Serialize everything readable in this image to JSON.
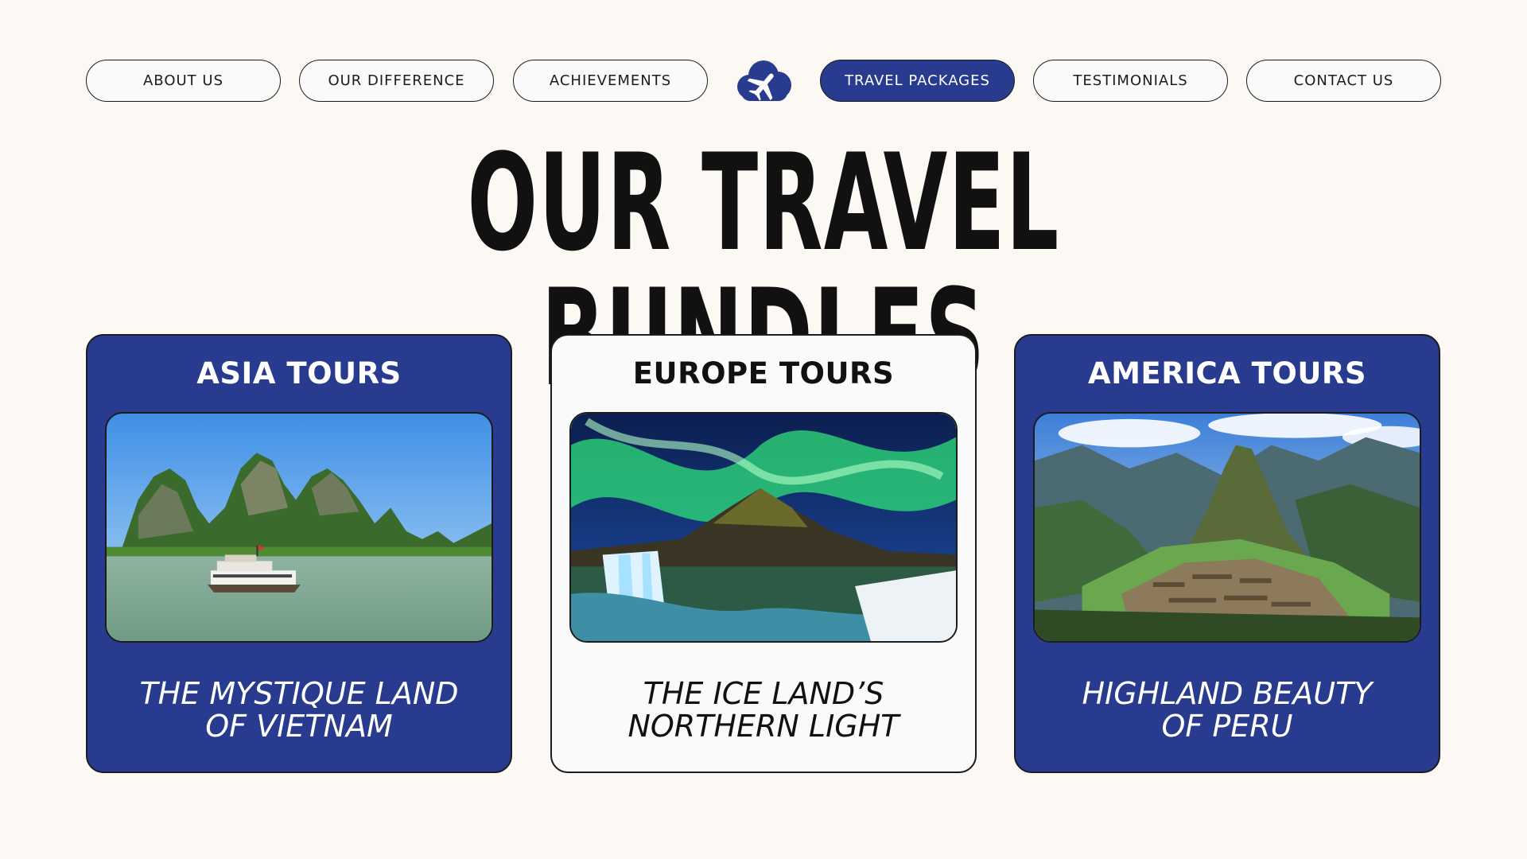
{
  "nav": {
    "items": [
      {
        "label": "ABOUT US",
        "active": false
      },
      {
        "label": "OUR DIFFERENCE",
        "active": false
      },
      {
        "label": "ACHIEVEMENTS",
        "active": false
      },
      {
        "label": "TRAVEL PACKAGES",
        "active": true
      },
      {
        "label": "TESTIMONIALS",
        "active": false
      },
      {
        "label": "CONTACT US",
        "active": false
      }
    ],
    "logo_icon": "cloud-airplane-icon"
  },
  "headline": "OUR TRAVEL BUNDLES",
  "cards": [
    {
      "title": "ASIA TOURS",
      "subtitle_line1": "THE MYSTIQUE LAND",
      "subtitle_line2": "OF VIETNAM",
      "photo": "halong-bay-boat-photo",
      "style": "blue"
    },
    {
      "title": "EUROPE TOURS",
      "subtitle_line1": "THE ICE LAND’S",
      "subtitle_line2": "NORTHERN LIGHT",
      "photo": "iceland-aurora-photo",
      "style": "light"
    },
    {
      "title": "AMERICA TOURS",
      "subtitle_line1": "HIGHLAND BEAUTY",
      "subtitle_line2": "OF PERU",
      "photo": "machu-picchu-photo",
      "style": "blue"
    }
  ],
  "colors": {
    "background": "#fcf8f3",
    "accent_blue": "#283b8f",
    "light_card": "#fafafa",
    "ink": "#111111"
  }
}
